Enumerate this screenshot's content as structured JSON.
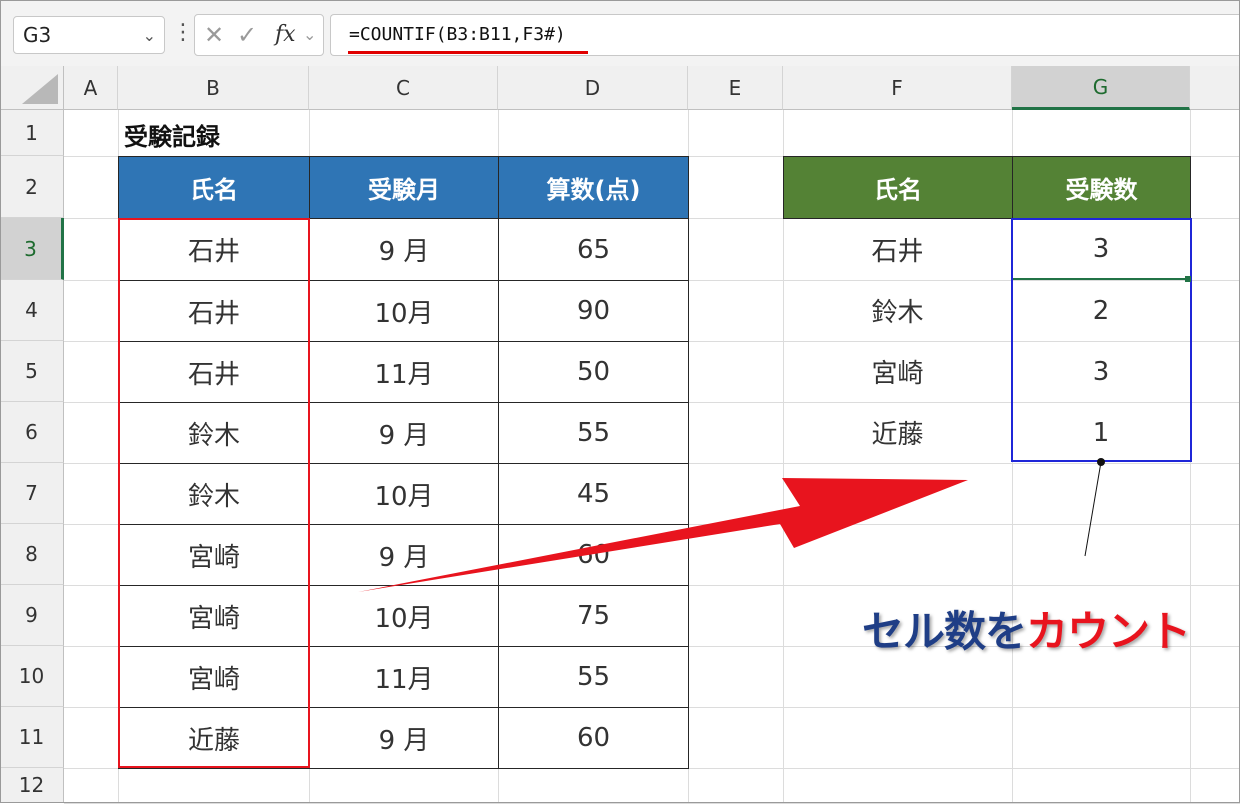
{
  "formula_bar": {
    "name_box": "G3",
    "formula": "=COUNTIF(B3:B11,F3#)",
    "cancel_icon": "cancel-x-icon",
    "enter_icon": "enter-check-icon",
    "function_icon": "insert-function-icon",
    "function_label": "fx"
  },
  "columns": [
    "A",
    "B",
    "C",
    "D",
    "E",
    "F",
    "G"
  ],
  "selected_column": "G",
  "rows": [
    "1",
    "2",
    "3",
    "4",
    "5",
    "6",
    "7",
    "8",
    "9",
    "10",
    "11",
    "12"
  ],
  "selected_row": "3",
  "sheet": {
    "title": "受験記録",
    "table1": {
      "headers": [
        "氏名",
        "受験月",
        "算数(点)"
      ],
      "header_color": "#2f75b5",
      "rows": [
        [
          "石井",
          "9 月",
          "65"
        ],
        [
          "石井",
          "10月",
          "90"
        ],
        [
          "石井",
          "11月",
          "50"
        ],
        [
          "鈴木",
          "9 月",
          "55"
        ],
        [
          "鈴木",
          "10月",
          "45"
        ],
        [
          "宮崎",
          "9 月",
          "60"
        ],
        [
          "宮崎",
          "10月",
          "75"
        ],
        [
          "宮崎",
          "11月",
          "55"
        ],
        [
          "近藤",
          "9 月",
          "60"
        ]
      ]
    },
    "table2": {
      "headers": [
        "氏名",
        "受験数"
      ],
      "header_color": "#548235",
      "rows": [
        [
          "石井",
          "3"
        ],
        [
          "鈴木",
          "2"
        ],
        [
          "宮崎",
          "3"
        ],
        [
          "近藤",
          "1"
        ]
      ]
    }
  },
  "annotation": {
    "text_part1": "セル数を",
    "text_part2": "カウント",
    "color_main": "#1f3e86",
    "color_accent": "#e8141e",
    "arrow_color": "#e8141e",
    "red_box_color": "#e8141e",
    "blue_box_color": "#1f26d8"
  }
}
